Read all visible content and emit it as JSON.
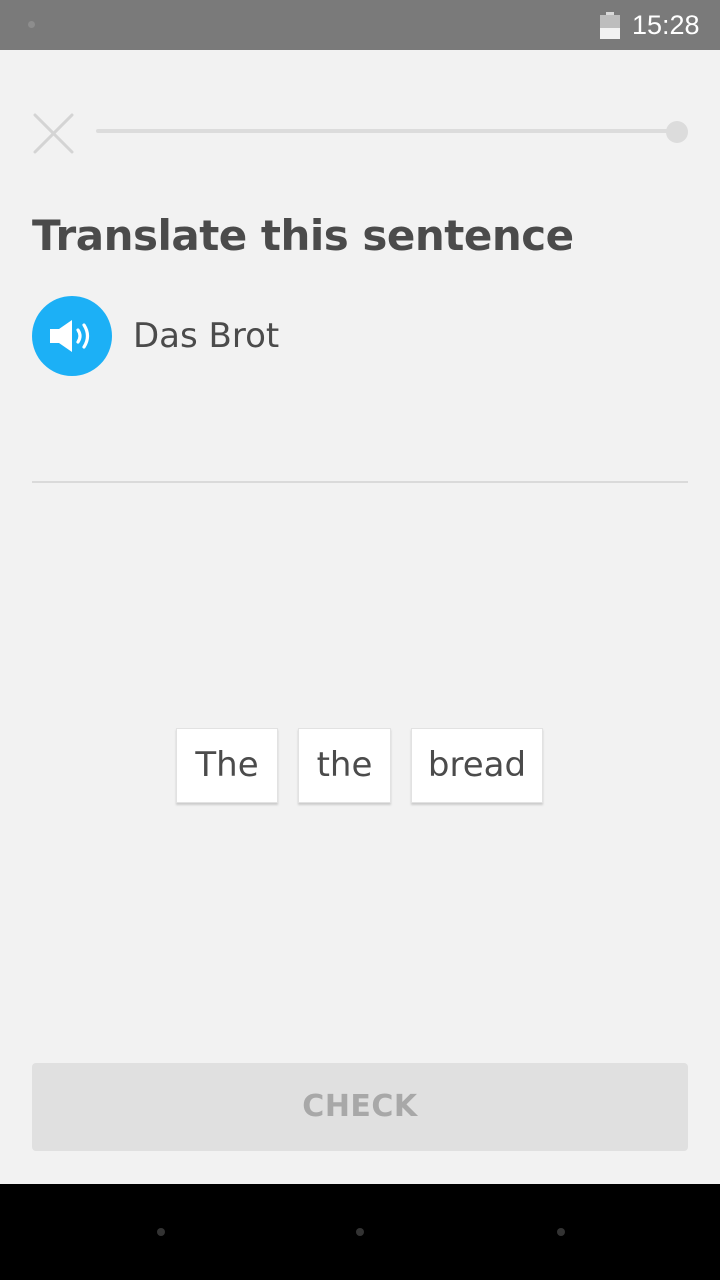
{
  "status_bar": {
    "time": "15:28",
    "battery_level": 0.54
  },
  "progress": {
    "value": 0,
    "close_icon": "close-icon"
  },
  "exercise": {
    "title": "Translate this sentence",
    "speaker_icon": "speaker-icon",
    "source_sentence": "Das Brot"
  },
  "word_bank": [
    "The",
    "the",
    "bread"
  ],
  "check_button": {
    "label": "CHECK",
    "enabled": false
  },
  "colors": {
    "background": "#f2f2f2",
    "speaker_blue": "#1cb0f6",
    "text": "#4b4b4b",
    "disabled_button": "#e0e0e0",
    "disabled_text": "#a8a8a8",
    "status_bar": "#7a7a7a"
  }
}
